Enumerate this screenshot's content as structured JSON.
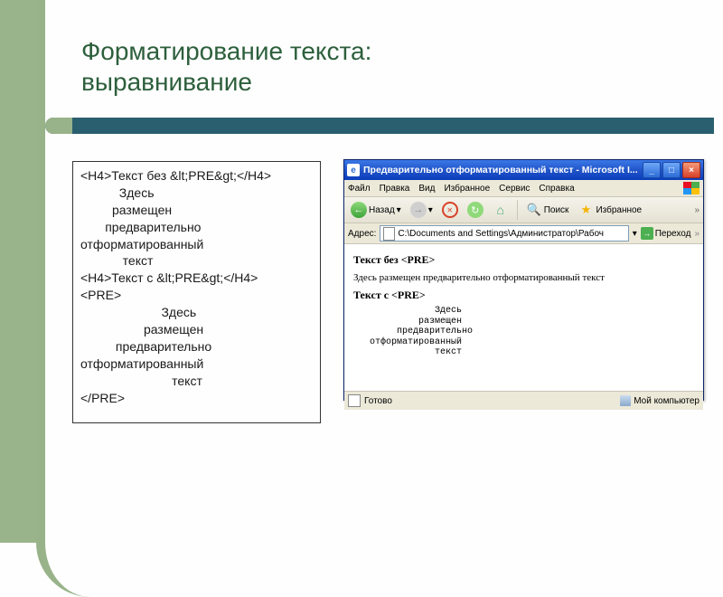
{
  "title": {
    "line1": "Форматирование текста:",
    "line2": "выравнивание"
  },
  "code": {
    "text": "<H4>Текст без &lt;PRE&gt;</H4>\n           Здесь\n         размещен\n       предварительно\nотформатированный\n            текст\n<H4>Текст с &lt;PRE&gt;</H4>\n<PRE>\n                       Здесь\n                  размещен\n          предварительно\nотформатированный\n                          текст\n</PRE>"
  },
  "ie": {
    "title": "Предварительно отформатированный текст - Microsoft I...",
    "menu": [
      "Файл",
      "Правка",
      "Вид",
      "Избранное",
      "Сервис",
      "Справка"
    ],
    "toolbar": {
      "back": "Назад",
      "search": "Поиск",
      "favorites": "Избранное"
    },
    "addressbar": {
      "label": "Адрес:",
      "path": "C:\\Documents and Settings\\Администратор\\Рабоч",
      "go": "Переход"
    },
    "content": {
      "h1": "Текст без <PRE>",
      "para": "Здесь размещен предварительно отформатированный текст",
      "h2": "Текст с <PRE>",
      "pre": "               Здесь\n            размещен\n        предварительно\n   отформатированный\n               текст"
    },
    "status": {
      "left": "Готово",
      "right": "Мой компьютер"
    }
  }
}
